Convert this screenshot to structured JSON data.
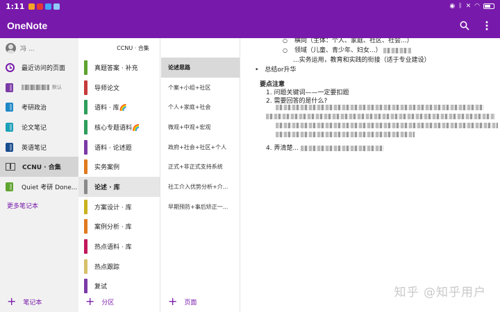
{
  "status_bar": {
    "time": "1:11"
  },
  "app": {
    "title": "OneNote"
  },
  "colors": {
    "brand": "#7719aa"
  },
  "notebooks": {
    "account_name": "冯 ... ",
    "recent_label": "最近访问的页面",
    "items": [
      {
        "label": "",
        "tag": "默认",
        "color": "#7c3aa6",
        "blurred": true
      },
      {
        "label": "考研政治",
        "color": "#1e88c7"
      },
      {
        "label": "论文笔记",
        "color": "#1ca0b8"
      },
      {
        "label": "英语笔记",
        "color": "#1a4d8f"
      },
      {
        "label": "CCNU · 合集",
        "active": true
      },
      {
        "label": "Quiet 考研 Done...",
        "color": "#5fa42e"
      }
    ],
    "more_label": "更多笔记本",
    "add_label": "笔记本"
  },
  "sections": {
    "header": "CCNU · 合集",
    "items": [
      {
        "label": "真题答案 · 补充",
        "color": "#5fa42e"
      },
      {
        "label": "导师论文",
        "color": "#c63b3b"
      },
      {
        "label": "语料 · 库🌈",
        "color": "#2e9e5b"
      },
      {
        "label": "核心专题语料🌈",
        "color": "#2e9e5b"
      },
      {
        "label": "语料 · 论述题",
        "color": "#7c3aa6"
      },
      {
        "label": "实务案例",
        "color": "#e07a1f"
      },
      {
        "label": "论述 · 库",
        "color": "#8a8a8a",
        "active": true
      },
      {
        "label": "方案设计 · 库",
        "color": "#c8b21e"
      },
      {
        "label": "案例分析 · 库",
        "color": "#e07a1f"
      },
      {
        "label": "热点语料 · 库",
        "color": "#c2185b"
      },
      {
        "label": "热点跟踪",
        "color": "#d7c06a"
      },
      {
        "label": "复试",
        "color": "#7c3aa6"
      }
    ],
    "add_label": "分区"
  },
  "pages": {
    "items": [
      {
        "label": "论述思路",
        "active": true
      },
      {
        "label": "个案+小组+社区"
      },
      {
        "label": "个人+家庭+社会"
      },
      {
        "label": "微观+中观+宏观"
      },
      {
        "label": "政府+社会+社区+个人"
      },
      {
        "label": "正式+非正式支持系统"
      },
      {
        "label": "社工介入优势分析+介..."
      },
      {
        "label": "早期预防+事后矫正一..."
      }
    ],
    "add_label": "页面"
  },
  "content": {
    "line1": "横向（主体：个人、家庭、社区、社会...）",
    "line2": "领域（儿童、青少年、妇女...）",
    "line3": "...实务运用，教育和实践的衔接（适于专业建设）",
    "summary": "总结or升华",
    "key_heading": "要点注意",
    "point1": "1.  问题关键词——一定要扣题",
    "point2": "2.  需要回答的是什么?",
    "point4": "4.  弄清楚... "
  },
  "watermark": "知乎 @知乎用户"
}
